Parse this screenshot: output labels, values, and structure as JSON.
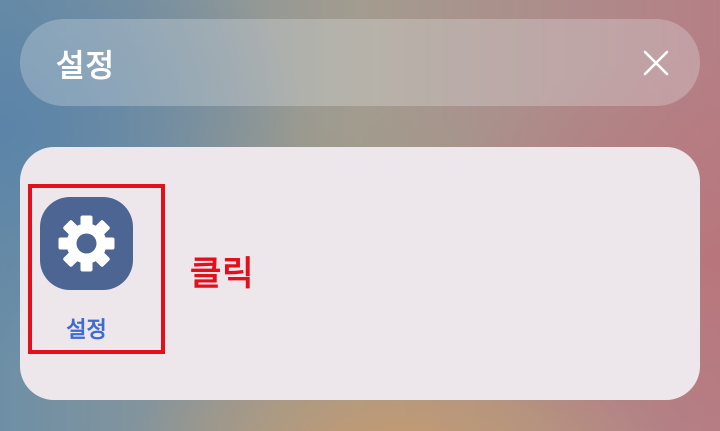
{
  "search": {
    "query": "설정"
  },
  "result": {
    "app_label": "설정",
    "app_icon": "gear-icon",
    "icon_color": "#4d6592",
    "label_color": "#3d6bd0"
  },
  "annotation": {
    "text": "클릭",
    "color": "#e3101c"
  }
}
